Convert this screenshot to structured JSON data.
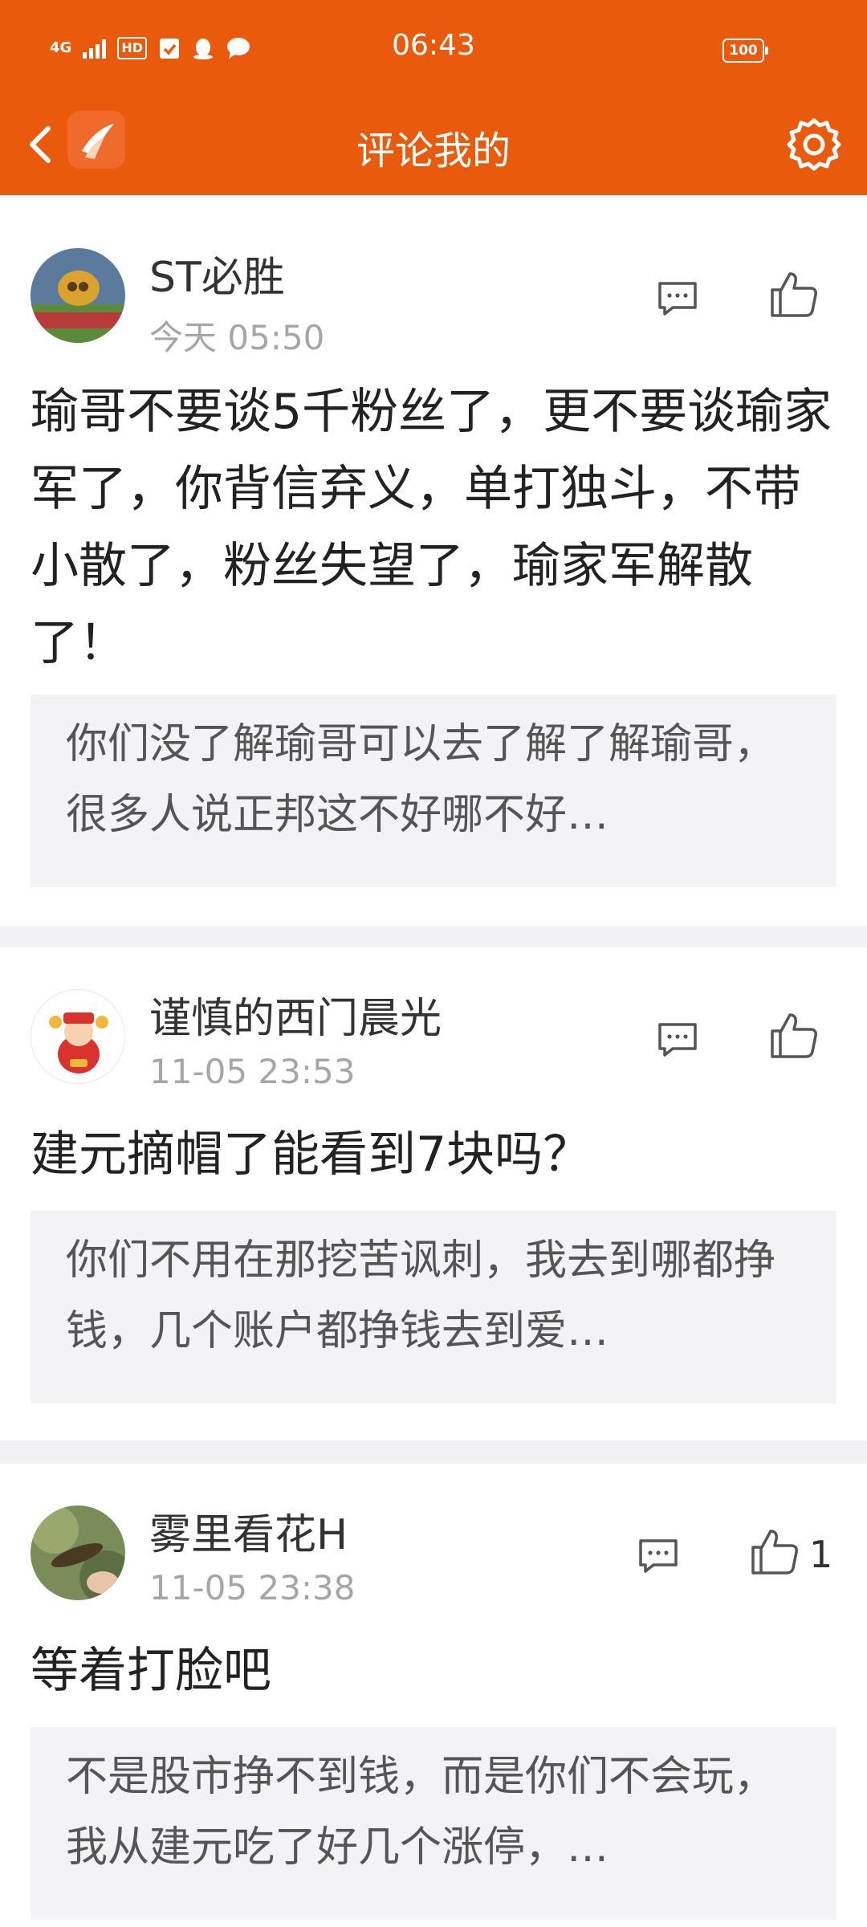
{
  "status": {
    "time": "06:43",
    "network": "4G",
    "hd": "HD",
    "battery": "100"
  },
  "header": {
    "title": "评论我的"
  },
  "comments": [
    {
      "user": "ST必胜",
      "time": "今天 05:50",
      "content": "瑜哥不要谈5千粉丝了，更不要谈瑜家军了，你背信弃义，单打独斗，不带小散了，粉丝失望了，瑜家军解散了！",
      "quote": "你们没了解瑜哥可以去了解了解瑜哥，很多人说正邦这不好哪不好…",
      "likes": ""
    },
    {
      "user": "谨慎的西门晨光",
      "time": "11-05 23:53",
      "content": "建元摘帽了能看到7块吗？",
      "quote": "你们不用在那挖苦讽刺，我去到哪都挣钱，几个账户都挣钱去到爱…",
      "likes": ""
    },
    {
      "user": "雾里看花H",
      "time": "11-05 23:38",
      "content": "等着打脸吧",
      "quote": "不是股市挣不到钱，而是你们不会玩，我从建元吃了好几个涨停，…",
      "likes": "1"
    }
  ],
  "colors": {
    "accent": "#ea5a0c",
    "muted": "#a6a6a6",
    "quote_bg": "#f3f3f6"
  }
}
